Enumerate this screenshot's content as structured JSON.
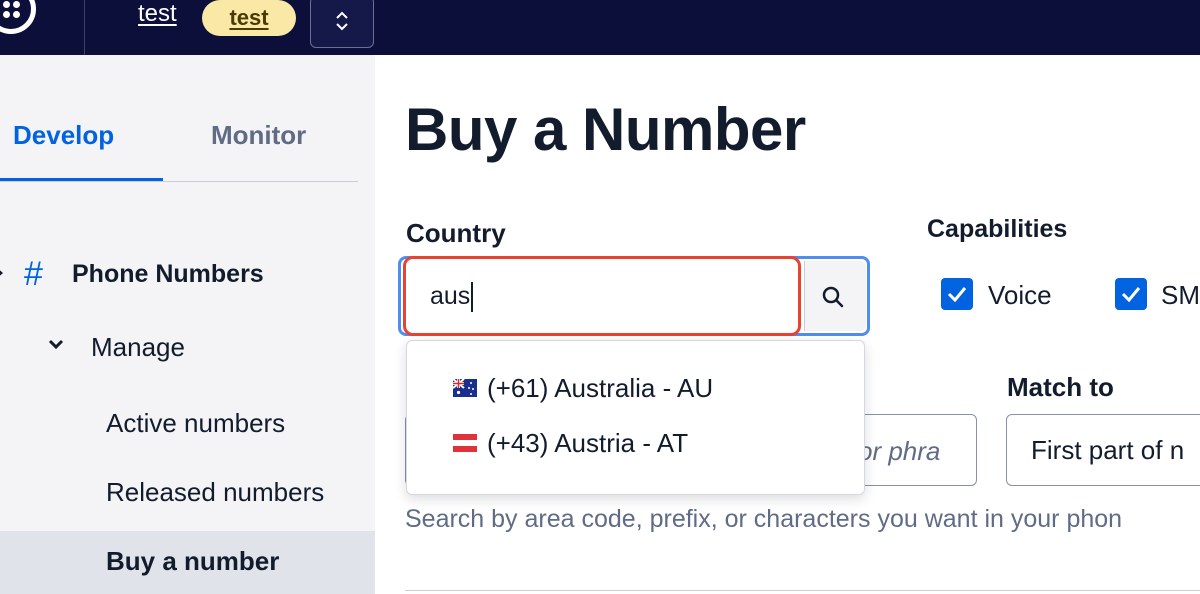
{
  "topbar": {
    "account_name": "test",
    "account_badge": "test"
  },
  "sidebar": {
    "tabs": [
      {
        "label": "Develop",
        "active": true
      },
      {
        "label": "Monitor",
        "active": false
      }
    ],
    "section": {
      "icon": "hash-icon",
      "label": "Phone Numbers"
    },
    "group": {
      "icon": "chevron-down-icon",
      "label": "Manage"
    },
    "items": [
      {
        "label": "Active numbers",
        "active": false
      },
      {
        "label": "Released numbers",
        "active": false
      },
      {
        "label": "Buy a number",
        "active": true
      }
    ]
  },
  "main": {
    "title": "Buy a Number",
    "country": {
      "label": "Country",
      "value": "aus",
      "search_icon": "search-icon"
    },
    "capabilities": {
      "label": "Capabilities",
      "options": [
        {
          "label": "Voice",
          "checked": true
        },
        {
          "label": "SM",
          "checked": true
        }
      ]
    },
    "contains": {
      "placeholder_visible": "or phra"
    },
    "match_to": {
      "label": "Match to",
      "value": "First part of n"
    },
    "help_text": "Search by area code, prefix, or characters you want in your phon",
    "country_options": [
      {
        "flag": "australia-flag-icon",
        "label": "(+61) Australia - AU"
      },
      {
        "flag": "austria-flag-icon",
        "label": "(+43) Austria - AT"
      }
    ]
  },
  "colors": {
    "topbar": "#0b0f3a",
    "accent": "#0263e0",
    "highlight": "#e8432e",
    "focus_ring": "#4f8ef0",
    "badge": "#f9e8a6"
  }
}
